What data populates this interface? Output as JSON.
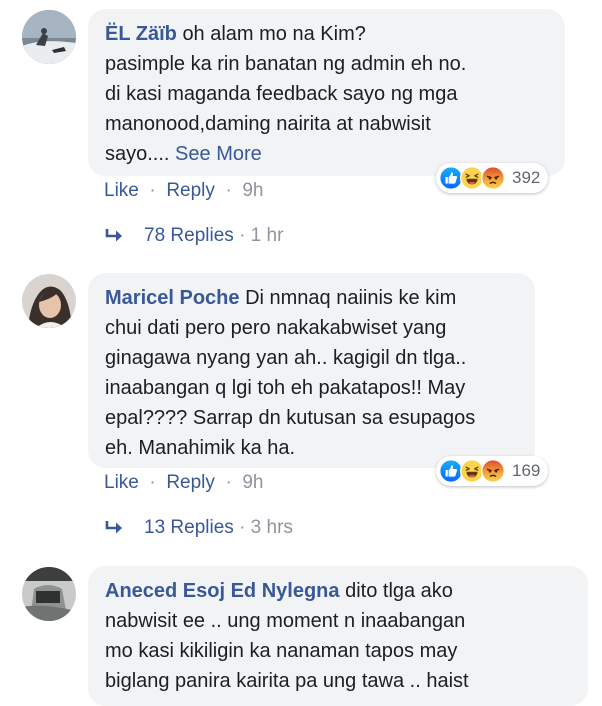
{
  "comments": [
    {
      "author": "ËL Zäïb",
      "lines": [
        "oh alam mo na Kim?",
        "pasimple ka rin banatan ng admin eh no.",
        "di kasi maganda feedback sayo ng mga",
        "manonood,daming nairita at nabwisit",
        "sayo...."
      ],
      "see_more": "See More",
      "reaction_count": "392",
      "reactions": [
        "like-icon",
        "haha-icon",
        "angry-icon"
      ],
      "like": "Like",
      "reply": "Reply",
      "time": "9h",
      "replies_label": "78 Replies",
      "replies_time": "1 hr"
    },
    {
      "author": "Maricel Poche",
      "lines": [
        "Di nmnaq naiinis ke kim",
        "chui dati pero pero nakakabwiset yang",
        "ginagawa nyang yan ah.. kagigil dn tlga..",
        "inaabangan q lgi toh eh pakatapos!! May",
        "epal???? Sarrap dn kutusan sa esupagos",
        "eh. Manahimik ka ha."
      ],
      "reaction_count": "169",
      "reactions": [
        "like-icon",
        "haha-icon",
        "angry-icon"
      ],
      "like": "Like",
      "reply": "Reply",
      "time": "9h",
      "replies_label": "13 Replies",
      "replies_time": "3 hrs"
    },
    {
      "author": "Aneced Esoj Ed Nylegna",
      "lines": [
        "dito tlga ako",
        "nabwisit ee .. ung moment n inaabangan",
        "mo kasi kikiligin ka nanaman tapos may",
        "biglang panira kairita pa ung tawa .. haist"
      ]
    }
  ],
  "colors": {
    "link": "#385898",
    "bubble": "#f2f3f5",
    "meta": "#90949c",
    "like": "#1877f2",
    "haha": "#f7b125",
    "angry": "#e9710f"
  },
  "separator": "·"
}
